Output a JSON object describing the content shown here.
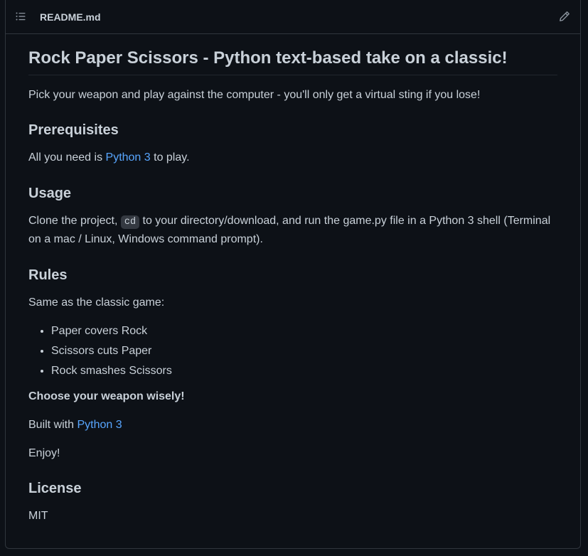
{
  "header": {
    "filename": "README.md",
    "toc_icon": "list-unordered-icon",
    "edit_icon": "pencil-icon"
  },
  "readme": {
    "title": "Rock Paper Scissors - Python text-based take on a classic!",
    "intro": "Pick your weapon and play against the computer - you'll only get a virtual sting if you lose!",
    "prereq_heading": "Prerequisites",
    "prereq_before": "All you need is ",
    "prereq_link": "Python 3",
    "prereq_after": " to play.",
    "usage_heading": "Usage",
    "usage_before": "Clone the project, ",
    "usage_code": "cd",
    "usage_after": " to your directory/download, and run the game.py file in a Python 3 shell (Terminal on a mac / Linux, Windows command prompt).",
    "rules_heading": "Rules",
    "rules_intro": "Same as the classic game:",
    "rules": [
      "Paper covers Rock",
      "Scissors cuts Paper",
      "Rock smashes Scissors"
    ],
    "choose": "Choose your weapon wisely!",
    "built_before": "Built with ",
    "built_link": "Python 3",
    "enjoy": "Enjoy!",
    "license_heading": "License",
    "license": "MIT"
  },
  "colors": {
    "background": "#0d1117",
    "text": "#c9d1d9",
    "link": "#58a6ff",
    "border": "#30363d"
  }
}
